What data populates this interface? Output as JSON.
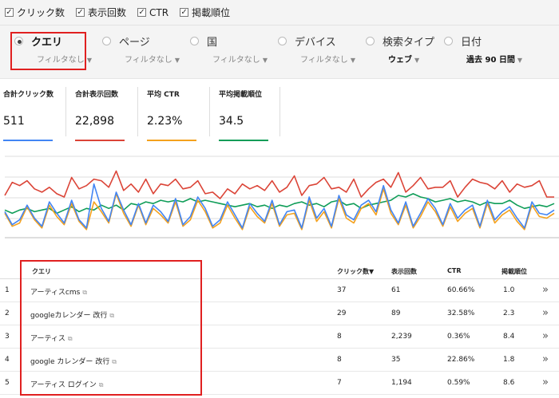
{
  "metrics": [
    {
      "label": "クリック数",
      "checked": "✓"
    },
    {
      "label": "表示回数",
      "checked": "✓"
    },
    {
      "label": "CTR",
      "checked": "✓"
    },
    {
      "label": "掲載順位",
      "checked": "✓"
    }
  ],
  "dimensions": [
    {
      "name": "クエリ",
      "filter": "フィルタなし"
    },
    {
      "name": "ページ",
      "filter": "フィルタなし"
    },
    {
      "name": "国",
      "filter": "フィルタなし"
    },
    {
      "name": "デバイス",
      "filter": "フィルタなし"
    },
    {
      "name": "検索タイプ",
      "filter": "ウェブ"
    },
    {
      "name": "日付",
      "filter": "過去 90 日間"
    }
  ],
  "cards": [
    {
      "title": "合計クリック数",
      "value": "511",
      "color": "#4285f4"
    },
    {
      "title": "合計表示回数",
      "value": "22,898",
      "color": "#db4437"
    },
    {
      "title": "平均 CTR",
      "value": "2.23%",
      "color": "#f4a11d"
    },
    {
      "title": "平均掲載順位",
      "value": "34.5",
      "color": "#0f9d58"
    }
  ],
  "table": {
    "headers": {
      "query": "クエリ",
      "clicks": "クリック数▼",
      "impressions": "表示回数",
      "ctr": "CTR",
      "position": "掲載順位"
    },
    "rows": [
      {
        "rank": "1",
        "query": "アーティスcms",
        "clicks": "37",
        "impressions": "61",
        "ctr": "60.66%",
        "position": "1.0"
      },
      {
        "rank": "2",
        "query": "googleカレンダー 改行",
        "clicks": "29",
        "impressions": "89",
        "ctr": "32.58%",
        "position": "2.3"
      },
      {
        "rank": "3",
        "query": "アーティス",
        "clicks": "8",
        "impressions": "2,239",
        "ctr": "0.36%",
        "position": "8.4"
      },
      {
        "rank": "4",
        "query": "google カレンダー 改行",
        "clicks": "8",
        "impressions": "35",
        "ctr": "22.86%",
        "position": "1.8"
      },
      {
        "rank": "5",
        "query": "アーティス ログイン",
        "clicks": "7",
        "impressions": "1,194",
        "ctr": "0.59%",
        "position": "8.6"
      }
    ]
  },
  "chart_data": {
    "type": "line",
    "grid": true,
    "series": [
      {
        "color": "#db4437",
        "values": [
          52,
          68,
          64,
          70,
          60,
          56,
          62,
          54,
          50,
          74,
          60,
          64,
          72,
          70,
          62,
          82,
          58,
          66,
          56,
          72,
          54,
          66,
          64,
          72,
          60,
          62,
          70,
          54,
          56,
          48,
          60,
          54,
          66,
          60,
          64,
          58,
          70,
          56,
          62,
          76,
          52,
          64,
          66,
          74,
          60,
          62,
          56,
          72,
          50,
          60,
          68,
          72,
          62,
          80,
          56,
          64,
          74,
          60,
          62,
          62,
          70,
          50,
          62,
          72,
          68,
          66,
          60,
          70,
          56,
          66,
          62,
          64,
          70,
          50,
          50
        ]
      },
      {
        "color": "#0f9d58",
        "values": [
          34,
          30,
          34,
          36,
          32,
          34,
          36,
          30,
          34,
          38,
          32,
          36,
          34,
          40,
          36,
          40,
          34,
          42,
          40,
          44,
          42,
          46,
          44,
          46,
          44,
          48,
          44,
          46,
          44,
          42,
          40,
          38,
          40,
          42,
          38,
          40,
          36,
          40,
          38,
          42,
          44,
          40,
          42,
          38,
          44,
          46,
          40,
          42,
          36,
          40,
          42,
          44,
          46,
          52,
          50,
          54,
          50,
          48,
          44,
          46,
          48,
          44,
          46,
          44,
          40,
          44,
          42,
          42,
          46,
          40,
          36,
          38,
          40,
          38,
          42
        ]
      },
      {
        "color": "#f4a11d",
        "values": [
          30,
          14,
          18,
          38,
          22,
          12,
          40,
          26,
          16,
          42,
          20,
          10,
          44,
          32,
          18,
          54,
          30,
          14,
          40,
          16,
          36,
          28,
          18,
          44,
          14,
          22,
          46,
          32,
          12,
          18,
          40,
          24,
          10,
          38,
          26,
          18,
          42,
          14,
          28,
          30,
          10,
          46,
          20,
          32,
          12,
          48,
          24,
          18,
          36,
          42,
          28,
          60,
          30,
          16,
          40,
          12,
          26,
          44,
          32,
          14,
          38,
          20,
          30,
          36,
          12,
          42,
          18,
          28,
          34,
          20,
          10,
          40,
          26,
          24,
          30
        ]
      },
      {
        "color": "#4285f4",
        "values": [
          32,
          16,
          22,
          40,
          24,
          14,
          44,
          30,
          18,
          46,
          22,
          12,
          66,
          36,
          20,
          56,
          34,
          16,
          42,
          18,
          40,
          32,
          20,
          48,
          16,
          26,
          50,
          36,
          14,
          22,
          44,
          28,
          12,
          42,
          30,
          20,
          46,
          16,
          32,
          34,
          12,
          50,
          24,
          36,
          14,
          52,
          28,
          22,
          40,
          46,
          32,
          64,
          34,
          18,
          44,
          14,
          30,
          48,
          36,
          16,
          42,
          24,
          34,
          40,
          14,
          46,
          22,
          32,
          38,
          24,
          12,
          44,
          30,
          28,
          34
        ]
      }
    ]
  }
}
